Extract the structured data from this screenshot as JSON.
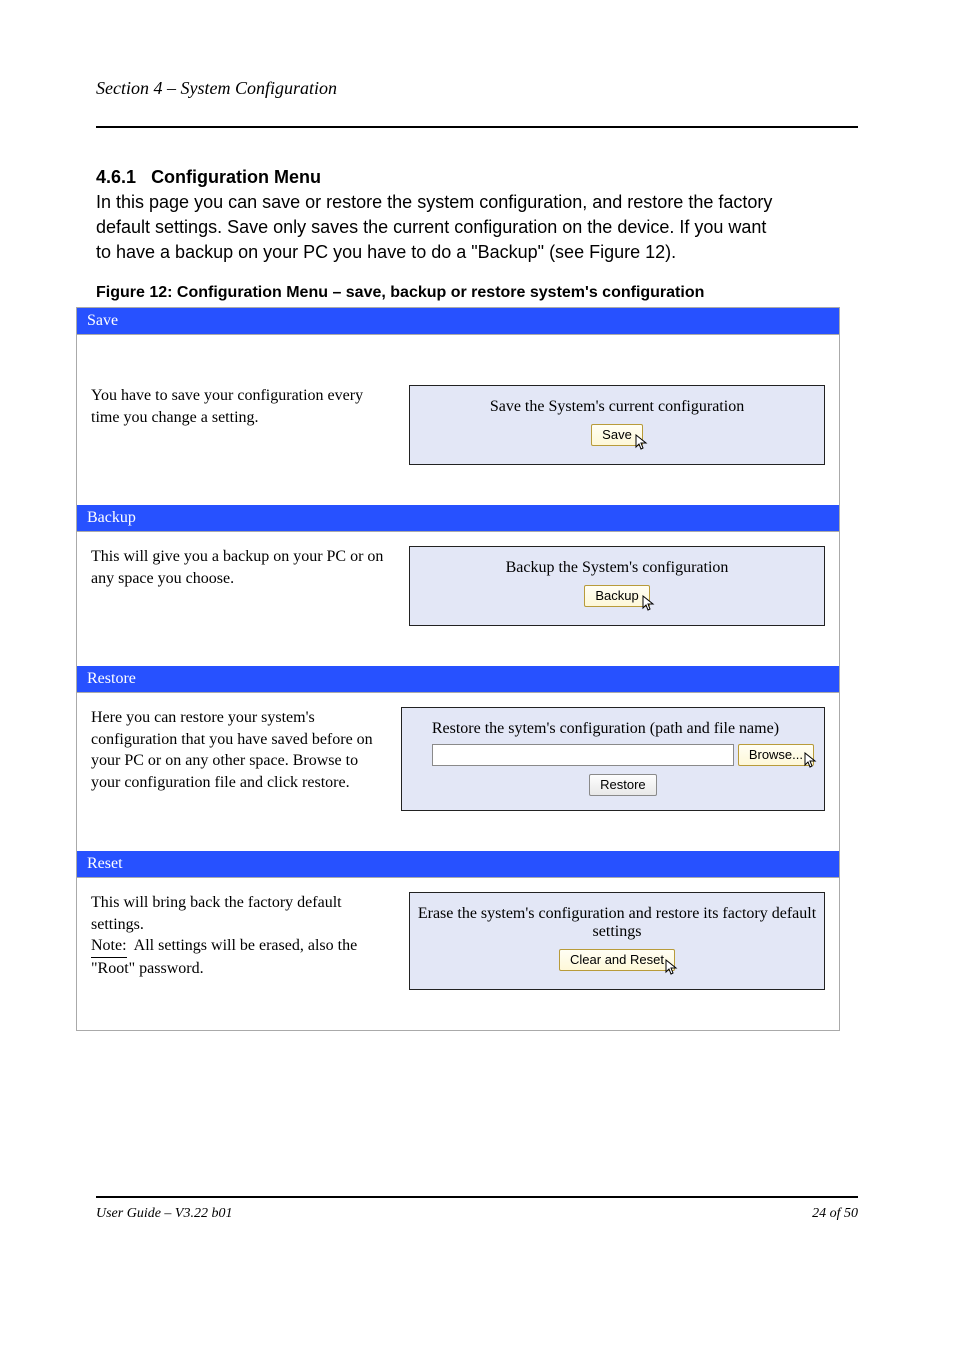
{
  "header": {
    "section_label": "Section 4 – System Configuration"
  },
  "intro": {
    "title": "Configuration Menu",
    "line1": "In this page you can save or restore the system configuration, and restore the factory",
    "line2": "default settings. Save only saves the current configuration on the device. If you want",
    "line3": "to have a backup on your PC you have to do a \"Backup\" (see Figure 12)."
  },
  "figure_caption": "Figure 12: Configuration Menu – save, backup or restore system's configuration",
  "sections": {
    "save": {
      "bar": "Save",
      "left": "You have to save your configuration every time you change a setting.",
      "box_desc": "Save the System's current configuration",
      "button": "Save"
    },
    "backup": {
      "bar": "Backup",
      "left": "This will give you a backup on your PC or on any space you choose.",
      "box_desc": "Backup the System's configuration",
      "button": "Backup"
    },
    "restore": {
      "bar": "Restore",
      "left": "Here you can restore your system's configuration that you have saved before on your PC or on any other space. Browse to your configuration file and click restore.",
      "box_desc": "Restore the sytem's configuration (path and file name)",
      "browse_button": "Browse...",
      "restore_button": "Restore"
    },
    "reset": {
      "bar": "Reset",
      "left_prefix": "This will bring back the factory default settings.",
      "note_label": "Note:",
      "note_text": "All settings will be erased, also the \"Root\" password.",
      "box_desc": "Erase the system's configuration and restore its factory default settings",
      "button": "Clear and Reset"
    }
  },
  "footer": {
    "left": "User Guide – V3.22 b01",
    "right": "24 of 50"
  }
}
